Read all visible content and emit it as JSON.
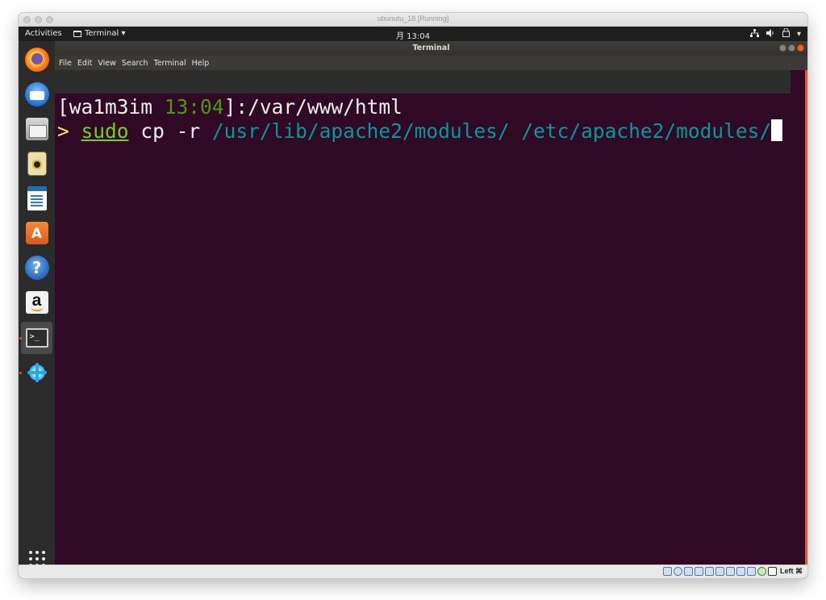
{
  "host": {
    "title": "ubunutu_18 [Running]",
    "host_key": "Left ⌘"
  },
  "topbar": {
    "activities": "Activities",
    "app_menu": "Terminal ▾",
    "clock": "月 13:04"
  },
  "terminal": {
    "window_title": "Terminal",
    "menu": [
      "File",
      "Edit",
      "View",
      "Search",
      "Terminal",
      "Help"
    ],
    "prompt": {
      "user": "wa1m3im",
      "time": "13:04",
      "path": ":/var/www/html"
    },
    "command": {
      "marker": ">",
      "sudo": "sudo",
      "cmd": "cp -r",
      "src": "/usr/lib/apache2/modules/",
      "dst": "/etc/apache2/modules/"
    }
  },
  "dock": {
    "items": [
      {
        "name": "firefox-icon",
        "label": ""
      },
      {
        "name": "thunderbird-icon",
        "label": ""
      },
      {
        "name": "files-icon",
        "label": ""
      },
      {
        "name": "rhythmbox-icon",
        "label": ""
      },
      {
        "name": "libreoffice-writer-icon",
        "label": ""
      },
      {
        "name": "software-store-icon",
        "label": "A"
      },
      {
        "name": "help-icon",
        "label": "?"
      },
      {
        "name": "amazon-icon",
        "label": "a"
      },
      {
        "name": "terminal-icon",
        "label": ">_"
      },
      {
        "name": "splash-app-icon",
        "label": ""
      }
    ],
    "active_index": 8
  },
  "colors": {
    "terminal_bg": "#300a24",
    "accent": "#e95420",
    "prompt_green": "#4e9a06",
    "path_cyan": "#06989a"
  }
}
